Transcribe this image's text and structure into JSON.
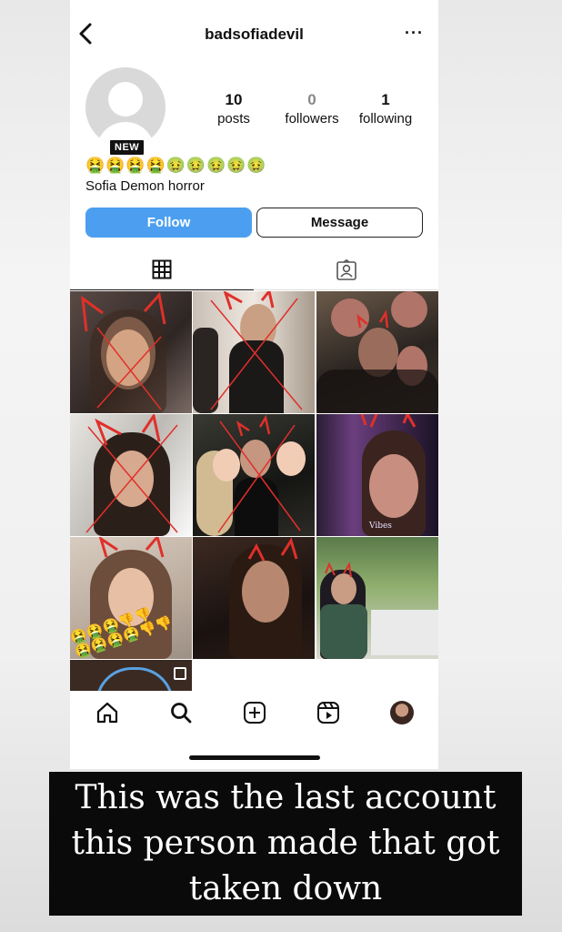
{
  "header": {
    "username": "badsofiadevil",
    "back_icon": "back-arrow-icon",
    "more_icon": "more-icon",
    "more_glyph": "···"
  },
  "profile": {
    "new_badge": "NEW",
    "posts_count": "10",
    "posts_label": "posts",
    "followers_count": "0",
    "followers_label": "followers",
    "following_count": "1",
    "following_label": "following",
    "bio_emojis": "🤮🤮🤮🤮🤢🤢🤢🤢🤢",
    "bio_name": "Sofia Demon horror"
  },
  "actions": {
    "follow_label": "Follow",
    "message_label": "Message"
  },
  "tabs": [
    {
      "name": "grid",
      "icon": "grid-icon"
    },
    {
      "name": "tagged",
      "icon": "tagged-icon"
    }
  ],
  "nav": [
    "home-icon",
    "search-icon",
    "create-icon",
    "reels-icon",
    "profile-avatar"
  ],
  "tile_overlay": {
    "vibes_text": "Vibes"
  },
  "caption": {
    "text": "This was the last account this person made that got taken down"
  },
  "colors": {
    "accent": "#4c9ff0",
    "drawing_red": "#e0302a"
  }
}
